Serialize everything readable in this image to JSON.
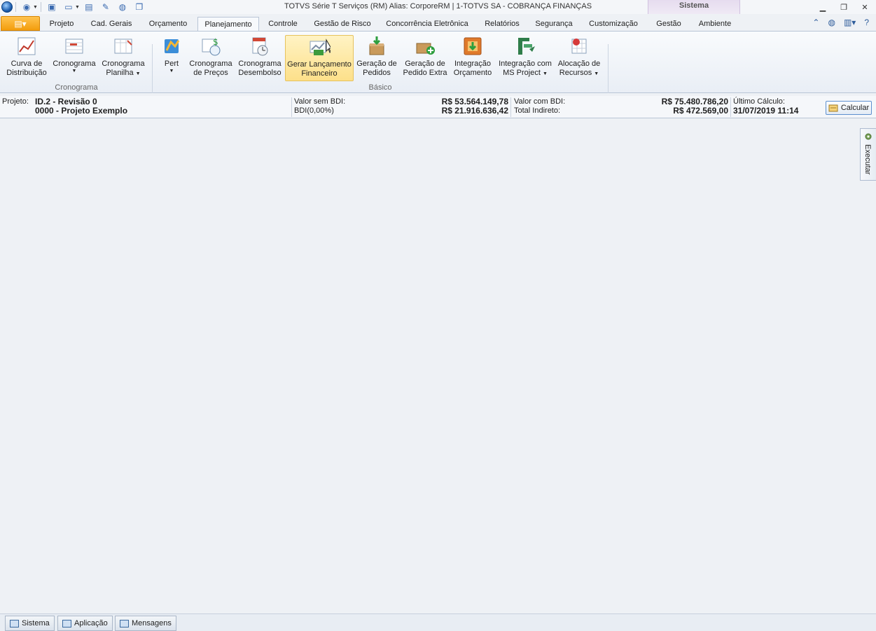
{
  "window": {
    "title": "TOTVS Série T Serviços (RM) Alias: CorporeRM | 1-TOTVS SA - COBRANÇA FINANÇAS",
    "context_tab": "Sistema"
  },
  "tabs": [
    {
      "label": "Projeto"
    },
    {
      "label": "Cad. Gerais"
    },
    {
      "label": "Orçamento"
    },
    {
      "label": "Planejamento"
    },
    {
      "label": "Controle"
    },
    {
      "label": "Gestão de Risco"
    },
    {
      "label": "Concorrência Eletrônica"
    },
    {
      "label": "Relatórios"
    },
    {
      "label": "Segurança"
    },
    {
      "label": "Customização"
    },
    {
      "label": "Gestão"
    },
    {
      "label": "Ambiente"
    }
  ],
  "active_tab": "Planejamento",
  "ribbon": {
    "buttons": [
      {
        "line1": "Curva de",
        "line2": "Distribuição",
        "icon": "distribution-curve-icon"
      },
      {
        "line1": "Cronograma",
        "line2": "",
        "icon": "schedule-icon",
        "dropdown": true
      },
      {
        "line1": "Cronograma",
        "line2": "Planilha",
        "icon": "schedule-sheet-icon",
        "dropdown": true
      },
      {
        "line1": "Pert",
        "line2": "",
        "icon": "pert-icon",
        "dropdown": true
      },
      {
        "line1": "Cronograma",
        "line2": "de Preços",
        "icon": "price-schedule-icon"
      },
      {
        "line1": "Cronograma",
        "line2": "Desembolso",
        "icon": "disbursement-schedule-icon"
      },
      {
        "line1": "Gerar Lançamento",
        "line2": "Financeiro",
        "icon": "financial-entry-icon"
      },
      {
        "line1": "Geração de",
        "line2": "Pedidos",
        "icon": "orders-icon"
      },
      {
        "line1": "Geração de",
        "line2": "Pedido Extra",
        "icon": "extra-order-icon"
      },
      {
        "line1": "Integração",
        "line2": "Orçamento",
        "icon": "budget-integration-icon"
      },
      {
        "line1": "Integração com",
        "line2": "MS Project",
        "icon": "ms-project-icon",
        "dropdown": true
      },
      {
        "line1": "Alocação de",
        "line2": "Recursos",
        "icon": "resource-allocation-icon",
        "dropdown": true
      }
    ],
    "groups": [
      {
        "label": "Cronograma"
      },
      {
        "label": "Básico"
      }
    ]
  },
  "infobar": {
    "project_label": "Projeto:",
    "project_id": "ID.2 - Revisão 0",
    "project_name": "0000 - Projeto Exemplo",
    "valor_sem_bdi_label": "Valor sem BDI:",
    "valor_sem_bdi": "R$ 53.564.149,78",
    "bdi_label": "BDI(0,00%)",
    "bdi_value": "R$ 21.916.636,42",
    "valor_com_bdi_label": "Valor com BDI:",
    "valor_com_bdi": "R$ 75.480.786,20",
    "total_indireto_label": "Total Indireto:",
    "total_indireto": "R$ 472.569,00",
    "ultimo_calculo_label": "Último Cálculo:",
    "ultimo_calculo": "31/07/2019 11:14",
    "calc_button": "Calcular"
  },
  "side_panel": {
    "label": "Executar"
  },
  "bottom_tabs": [
    {
      "label": "Sistema"
    },
    {
      "label": "Aplicação"
    },
    {
      "label": "Mensagens"
    }
  ]
}
